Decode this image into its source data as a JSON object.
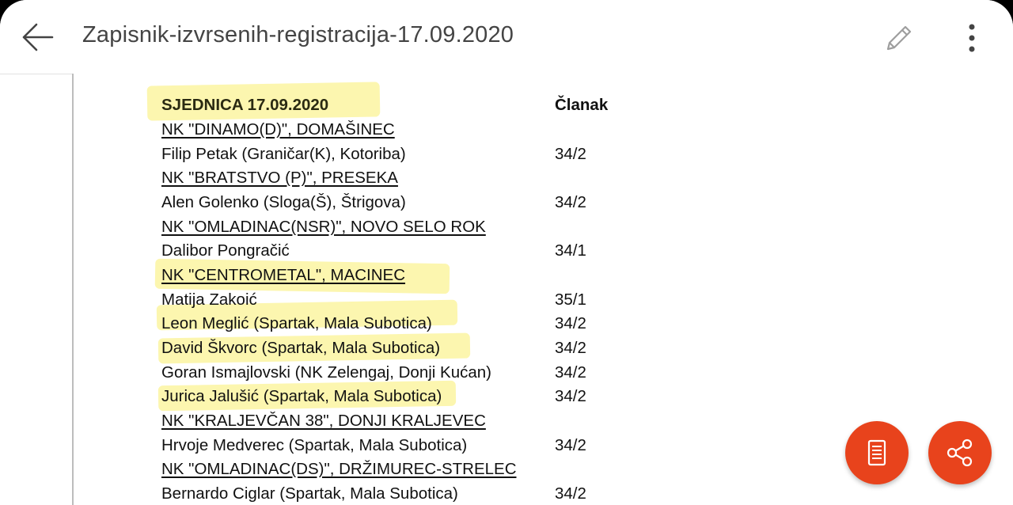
{
  "header": {
    "title": "Zapisnik-izvrsenih-registracija-17.09.2020",
    "back_icon": "arrow-left-icon",
    "edit_icon": "pencil-icon",
    "more_icon": "more-vertical-icon"
  },
  "document": {
    "session_title": "SJEDNICA 17.09.2020",
    "article_header": "Članak",
    "rows": [
      {
        "text": "NK \"DINAMO(D)\", DOMAŠINEC",
        "article": "",
        "type": "club"
      },
      {
        "text": "Filip Petak (Graničar(K), Kotoriba)",
        "article": "34/2",
        "type": "player"
      },
      {
        "text": "NK \"BRATSTVO (P)\", PRESEKA",
        "article": "",
        "type": "club"
      },
      {
        "text": "Alen Golenko (Sloga(Š), Štrigova)",
        "article": "34/2",
        "type": "player"
      },
      {
        "text": "NK \"OMLADINAC(NSR)\", NOVO SELO ROK",
        "article": "",
        "type": "club"
      },
      {
        "text": "Dalibor Pongračić",
        "article": "34/1",
        "type": "player"
      },
      {
        "text": "NK \"CENTROMETAL\", MACINEC",
        "article": "",
        "type": "club"
      },
      {
        "text": "Matija Zakoić",
        "article": "35/1",
        "type": "player"
      },
      {
        "text": "Leon Meglić (Spartak, Mala Subotica)",
        "article": "34/2",
        "type": "player"
      },
      {
        "text": "David Škvorc (Spartak, Mala Subotica)",
        "article": "34/2",
        "type": "player"
      },
      {
        "text": "Goran Ismajlovski (NK Zelengaj, Donji Kućan)",
        "article": "34/2",
        "type": "player"
      },
      {
        "text": "Jurica Jalušić (Spartak, Mala Subotica)",
        "article": "34/2",
        "type": "player"
      },
      {
        "text": "NK \"KRALJEVČAN 38\", DONJI KRALJEVEC",
        "article": "",
        "type": "club"
      },
      {
        "text": "Hrvoje Medverec (Spartak, Mala Subotica)",
        "article": "34/2",
        "type": "player"
      },
      {
        "text": "NK \"OMLADINAC(DS)\", DRŽIMUREC-STRELEC",
        "article": "",
        "type": "club"
      },
      {
        "text": "Bernardo Ciglar (Spartak, Mala Subotica)",
        "article": "34/2",
        "type": "player"
      }
    ]
  },
  "fabs": {
    "reader_icon": "reading-mode-icon",
    "share_icon": "share-icon",
    "color": "#e8431c"
  },
  "colors": {
    "highlight": "#faee6e",
    "accent": "#e8431c"
  }
}
